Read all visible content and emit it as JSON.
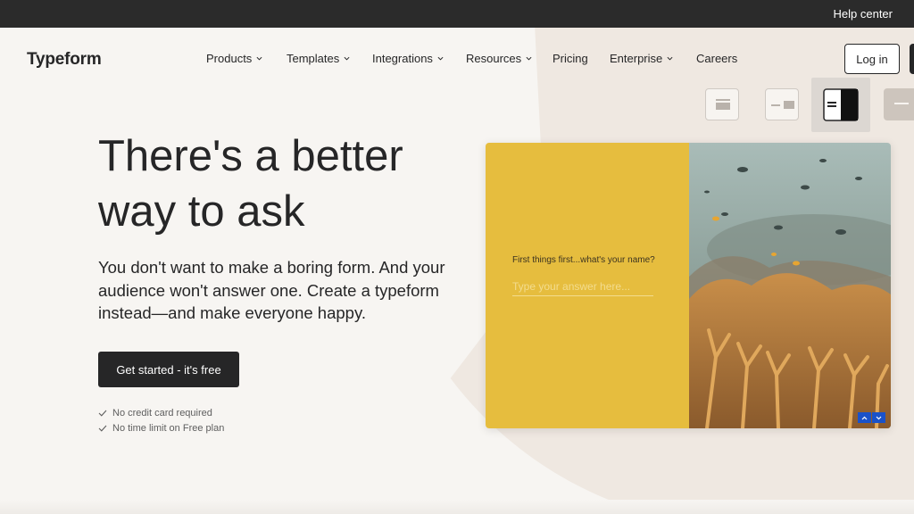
{
  "topbar": {
    "help_label": "Help center"
  },
  "header": {
    "logo": "Typeform",
    "nav": [
      {
        "label": "Products",
        "dropdown": true
      },
      {
        "label": "Templates",
        "dropdown": true
      },
      {
        "label": "Integrations",
        "dropdown": true
      },
      {
        "label": "Resources",
        "dropdown": true
      },
      {
        "label": "Pricing",
        "dropdown": false
      },
      {
        "label": "Enterprise",
        "dropdown": true
      },
      {
        "label": "Careers",
        "dropdown": false
      }
    ],
    "login_label": "Log in"
  },
  "hero": {
    "headline_line1": "There's a better",
    "headline_line2": "way to ask",
    "subtext": "You don't want to make a boring form. And your audience won't answer one. Create a typeform instead—and make everyone happy.",
    "cta_label": "Get started - it's free",
    "perks": [
      "No credit card required",
      "No time limit on Free plan"
    ]
  },
  "preview": {
    "question": "First things first...what's your name?",
    "answer_placeholder": "Type your answer here...",
    "layout_options": [
      "layout-stack-icon",
      "layout-split-icon",
      "layout-side-image-icon",
      "layout-text-only-icon"
    ],
    "active_layout_index": 2
  },
  "colors": {
    "dark": "#262627",
    "background": "#f7f5f2",
    "accent_yellow": "#e6bd3e",
    "nav_blue": "#1a52c9"
  }
}
